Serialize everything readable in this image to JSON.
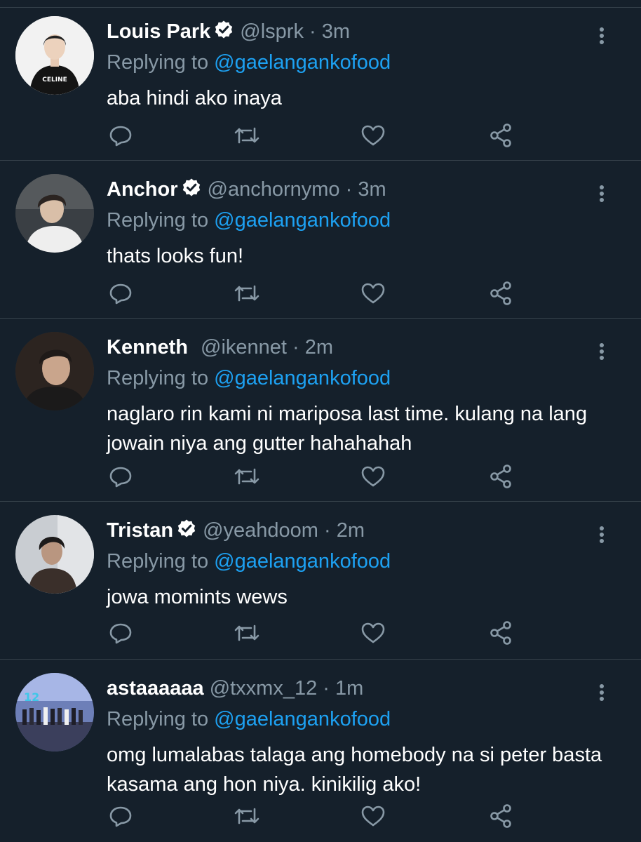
{
  "tweets": [
    {
      "name": "Louis Park",
      "verified": true,
      "handle": "@lsprk",
      "time": "3m",
      "replying_prefix": "Replying to ",
      "replying_to": "@gaelangankofood",
      "text": "aba hindi ako inaya",
      "avatar_text": "CELINE"
    },
    {
      "name": "Anchor",
      "verified": true,
      "handle": "@anchornymo",
      "time": "3m",
      "replying_prefix": "Replying to ",
      "replying_to": "@gaelangankofood",
      "text": "thats looks fun!"
    },
    {
      "name": "Kenneth",
      "verified": false,
      "handle": "@ikennet",
      "time": "2m",
      "replying_prefix": "Replying to ",
      "replying_to": "@gaelangankofood",
      "text": "naglaro rin kami ni mariposa last time. kulang na lang jowain niya ang gutter hahahahah"
    },
    {
      "name": "Tristan",
      "verified": true,
      "handle": "@yeahdoom",
      "time": "2m",
      "replying_prefix": "Replying to ",
      "replying_to": "@gaelangankofood",
      "text": "jowa momints wews"
    },
    {
      "name": "astaaaaaa",
      "verified": false,
      "handle": "@txxmx_12",
      "time": "1m",
      "replying_prefix": "Replying to ",
      "replying_to": "@gaelangankofood",
      "text": "omg lumalabas talaga ang homebody na si peter basta kasama ang hon niya. kinikilig ako!",
      "avatar_text": "12"
    }
  ],
  "separator": " · ",
  "icons": {
    "reply": "reply-icon",
    "retweet": "retweet-icon",
    "like": "heart-icon",
    "share": "share-icon",
    "more": "more-vertical-icon",
    "verified": "verified-badge-icon"
  },
  "colors": {
    "background": "#15202b",
    "secondary_text": "#8899a6",
    "link": "#1da1f2",
    "divider": "#38444d"
  }
}
